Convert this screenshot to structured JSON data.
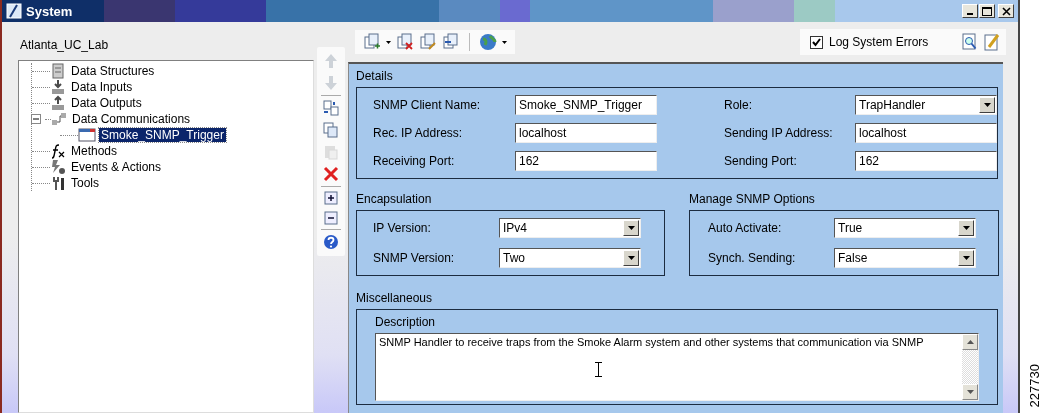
{
  "window": {
    "title": "System"
  },
  "workspace": {
    "label": "Atlanta_UC_Lab"
  },
  "tree": [
    {
      "label": "Data Structures",
      "selected": false
    },
    {
      "label": "Data Inputs",
      "selected": false
    },
    {
      "label": "Data Outputs",
      "selected": false
    },
    {
      "label": "Data Communications",
      "selected": false,
      "expanded": true,
      "children": [
        {
          "label": "Smoke_SNMP_Trigger",
          "selected": true
        }
      ]
    },
    {
      "label": "Methods",
      "selected": false
    },
    {
      "label": "Events & Actions",
      "selected": false
    },
    {
      "label": "Tools",
      "selected": false
    }
  ],
  "vertical_toolbar": [
    [
      {
        "disabled": true
      },
      {
        "disabled": true
      }
    ],
    [
      {
        "disabled": false
      },
      {
        "disabled": false
      },
      {
        "disabled": true
      },
      {
        "disabled": false
      }
    ],
    [
      {
        "disabled": false
      },
      {
        "disabled": false
      }
    ],
    [
      {
        "disabled": false
      }
    ]
  ],
  "log_system_errors": {
    "label": "Log System Errors",
    "checked": true
  },
  "details": {
    "title": "Details",
    "fields": [
      {
        "label": "SNMP Client Name:",
        "value": "Smoke_SNMP_Trigger",
        "kind": "text"
      },
      {
        "label": "Role:",
        "value": "TrapHandler",
        "kind": "select"
      },
      {
        "label": "Rec. IP Address:",
        "value": "localhost",
        "kind": "text"
      },
      {
        "label": "Sending IP Address:",
        "value": "localhost",
        "kind": "text"
      },
      {
        "label": "Receiving Port:",
        "value": "162",
        "kind": "text"
      },
      {
        "label": "Sending Port:",
        "value": "162",
        "kind": "text"
      }
    ]
  },
  "encapsulation": {
    "title": "Encapsulation",
    "fields": [
      {
        "label": "IP Version:",
        "value": "IPv4",
        "kind": "select"
      },
      {
        "label": "SNMP Version:",
        "value": "Two",
        "kind": "select"
      }
    ]
  },
  "manage_snmp_options": {
    "title": "Manage SNMP Options",
    "fields": [
      {
        "label": "Auto Activate:",
        "value": "True",
        "kind": "select"
      },
      {
        "label": "Synch. Sending:",
        "value": "False",
        "kind": "select"
      }
    ]
  },
  "miscellaneous": {
    "title": "Miscellaneous",
    "description": {
      "label": "Description",
      "value": "SNMP Handler to receive traps from the Smoke Alarm system and other systems that communication via SNMP"
    }
  },
  "figure_id": "227730"
}
